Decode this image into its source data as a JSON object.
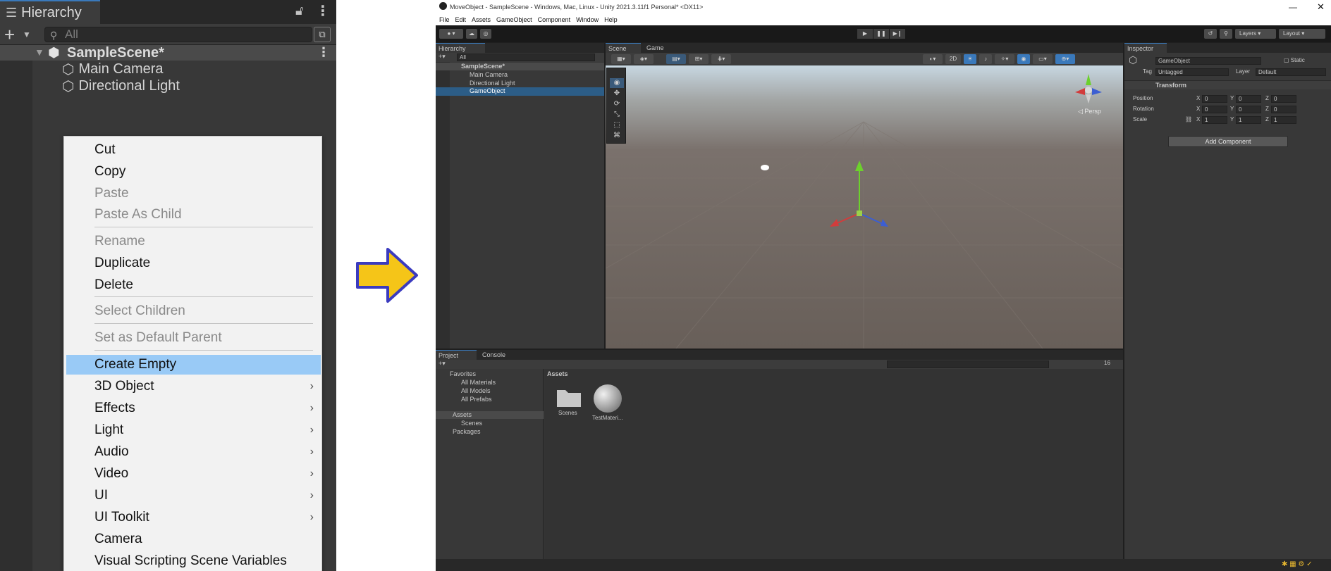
{
  "left": {
    "tab_title": "Hierarchy",
    "search_placeholder": "All",
    "scene_name": "SampleScene*",
    "objects": [
      "Main Camera",
      "Directional Light"
    ],
    "menu": [
      {
        "label": "Cut",
        "disabled": false
      },
      {
        "label": "Copy",
        "disabled": false
      },
      {
        "label": "Paste",
        "disabled": true
      },
      {
        "label": "Paste As Child",
        "disabled": true
      },
      {
        "label": "Rename",
        "disabled": true
      },
      {
        "label": "Duplicate",
        "disabled": false
      },
      {
        "label": "Delete",
        "disabled": false
      },
      {
        "label": "Select Children",
        "disabled": true
      },
      {
        "label": "Set as Default Parent",
        "disabled": true
      },
      {
        "label": "Create Empty",
        "disabled": false,
        "highlight": true
      },
      {
        "label": "3D Object",
        "disabled": false,
        "submenu": true
      },
      {
        "label": "Effects",
        "disabled": false,
        "submenu": true
      },
      {
        "label": "Light",
        "disabled": false,
        "submenu": true
      },
      {
        "label": "Audio",
        "disabled": false,
        "submenu": true
      },
      {
        "label": "Video",
        "disabled": false,
        "submenu": true
      },
      {
        "label": "UI",
        "disabled": false,
        "submenu": true
      },
      {
        "label": "UI Toolkit",
        "disabled": false,
        "submenu": true
      },
      {
        "label": "Camera",
        "disabled": false
      },
      {
        "label": "Visual Scripting Scene Variables",
        "disabled": false
      }
    ],
    "highlight_color": "#99caf6"
  },
  "arrow": {
    "fill": "#f5c518",
    "stroke": "#3b3bbf"
  },
  "editor": {
    "title": "MoveObject - SampleScene - Windows, Mac, Linux - Unity 2021.3.11f1 Personal* <DX11>",
    "menubar": [
      "File",
      "Edit",
      "Assets",
      "GameObject",
      "Component",
      "Window",
      "Help"
    ],
    "toolbar_right": {
      "layers": "Layers",
      "layout": "Layout"
    },
    "hierarchy": {
      "tab": "Hierarchy",
      "search_placeholder": "All",
      "scene": "SampleScene*",
      "items": [
        "Main Camera",
        "Directional Light",
        "GameObject"
      ],
      "selected": "GameObject"
    },
    "scene_tabs": [
      "Scene",
      "Game"
    ],
    "scene_toggle_2d": "2D",
    "persp_label": "Persp",
    "inspector": {
      "tab": "Inspector",
      "object_name": "GameObject",
      "static_label": "Static",
      "tag_label": "Tag",
      "tag_value": "Untagged",
      "layer_label": "Layer",
      "layer_value": "Default",
      "component": "Transform",
      "rows": [
        {
          "label": "Position",
          "x": "0",
          "y": "0",
          "z": "0"
        },
        {
          "label": "Rotation",
          "x": "0",
          "y": "0",
          "z": "0"
        },
        {
          "label": "Scale",
          "x": "1",
          "y": "1",
          "z": "1"
        }
      ],
      "axis_labels": [
        "X",
        "Y",
        "Z"
      ],
      "add_component": "Add Component"
    },
    "project": {
      "tabs": [
        "Project",
        "Console"
      ],
      "favorites_label": "Favorites",
      "favorites": [
        "All Materials",
        "All Models",
        "All Prefabs"
      ],
      "assets_label": "Assets",
      "asset_folders": [
        "Scenes"
      ],
      "packages_label": "Packages",
      "breadcrumb": "Assets",
      "grid_items": [
        "Scenes",
        "TestMateri..."
      ],
      "hidden_count": "16"
    }
  }
}
